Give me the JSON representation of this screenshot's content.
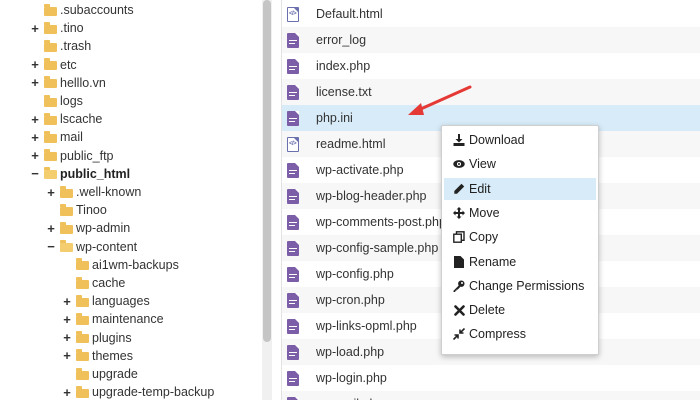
{
  "tree": [
    {
      "label": ".subaccounts",
      "toggle": "",
      "depth": 0,
      "bold": false
    },
    {
      "label": ".tino",
      "toggle": "+",
      "depth": 0,
      "bold": false
    },
    {
      "label": ".trash",
      "toggle": "",
      "depth": 0,
      "bold": false
    },
    {
      "label": "etc",
      "toggle": "+",
      "depth": 0,
      "bold": false
    },
    {
      "label": "helllo.vn",
      "toggle": "+",
      "depth": 0,
      "bold": false
    },
    {
      "label": "logs",
      "toggle": "",
      "depth": 0,
      "bold": false
    },
    {
      "label": "lscache",
      "toggle": "+",
      "depth": 0,
      "bold": false
    },
    {
      "label": "mail",
      "toggle": "+",
      "depth": 0,
      "bold": false
    },
    {
      "label": "public_ftp",
      "toggle": "+",
      "depth": 0,
      "bold": false
    },
    {
      "label": "public_html",
      "toggle": "−",
      "depth": 0,
      "bold": true
    },
    {
      "label": ".well-known",
      "toggle": "+",
      "depth": 1,
      "bold": false
    },
    {
      "label": "Tinoo",
      "toggle": "",
      "depth": 1,
      "bold": false
    },
    {
      "label": "wp-admin",
      "toggle": "+",
      "depth": 1,
      "bold": false
    },
    {
      "label": "wp-content",
      "toggle": "−",
      "depth": 1,
      "bold": false
    },
    {
      "label": "ai1wm-backups",
      "toggle": "",
      "depth": 2,
      "bold": false
    },
    {
      "label": "cache",
      "toggle": "",
      "depth": 2,
      "bold": false
    },
    {
      "label": "languages",
      "toggle": "+",
      "depth": 2,
      "bold": false
    },
    {
      "label": "maintenance",
      "toggle": "+",
      "depth": 2,
      "bold": false
    },
    {
      "label": "plugins",
      "toggle": "+",
      "depth": 2,
      "bold": false
    },
    {
      "label": "themes",
      "toggle": "+",
      "depth": 2,
      "bold": false
    },
    {
      "label": "upgrade",
      "toggle": "",
      "depth": 2,
      "bold": false
    },
    {
      "label": "upgrade-temp-backup",
      "toggle": "+",
      "depth": 2,
      "bold": false
    }
  ],
  "files": [
    {
      "name": "Default.html",
      "icon": "code-file-icon"
    },
    {
      "name": "error_log",
      "icon": "text-file-icon"
    },
    {
      "name": "index.php",
      "icon": "text-file-icon"
    },
    {
      "name": "license.txt",
      "icon": "text-file-icon"
    },
    {
      "name": "php.ini",
      "icon": "text-file-icon",
      "selected": true
    },
    {
      "name": "readme.html",
      "icon": "code-file-icon"
    },
    {
      "name": "wp-activate.php",
      "icon": "text-file-icon"
    },
    {
      "name": "wp-blog-header.php",
      "icon": "text-file-icon"
    },
    {
      "name": "wp-comments-post.php",
      "icon": "text-file-icon"
    },
    {
      "name": "wp-config-sample.php",
      "icon": "text-file-icon"
    },
    {
      "name": "wp-config.php",
      "icon": "text-file-icon"
    },
    {
      "name": "wp-cron.php",
      "icon": "text-file-icon"
    },
    {
      "name": "wp-links-opml.php",
      "icon": "text-file-icon"
    },
    {
      "name": "wp-load.php",
      "icon": "text-file-icon"
    },
    {
      "name": "wp-login.php",
      "icon": "text-file-icon"
    },
    {
      "name": "wp-mail.php",
      "icon": "text-file-icon"
    }
  ],
  "context_menu": [
    {
      "label": "Download",
      "icon": "download-icon"
    },
    {
      "label": "View",
      "icon": "eye-icon"
    },
    {
      "label": "Edit",
      "icon": "pencil-icon",
      "highlighted": true
    },
    {
      "label": "Move",
      "icon": "move-arrows-icon"
    },
    {
      "label": "Copy",
      "icon": "copy-icon"
    },
    {
      "label": "Rename",
      "icon": "file-icon"
    },
    {
      "label": "Change Permissions",
      "icon": "key-icon"
    },
    {
      "label": "Delete",
      "icon": "x-icon"
    },
    {
      "label": "Compress",
      "icon": "compress-icon"
    }
  ],
  "colors": {
    "folder": "#f0c15a",
    "file_icon": "#7b5ea7",
    "selection": "#d7ebf8",
    "arrow": "#e53935"
  }
}
